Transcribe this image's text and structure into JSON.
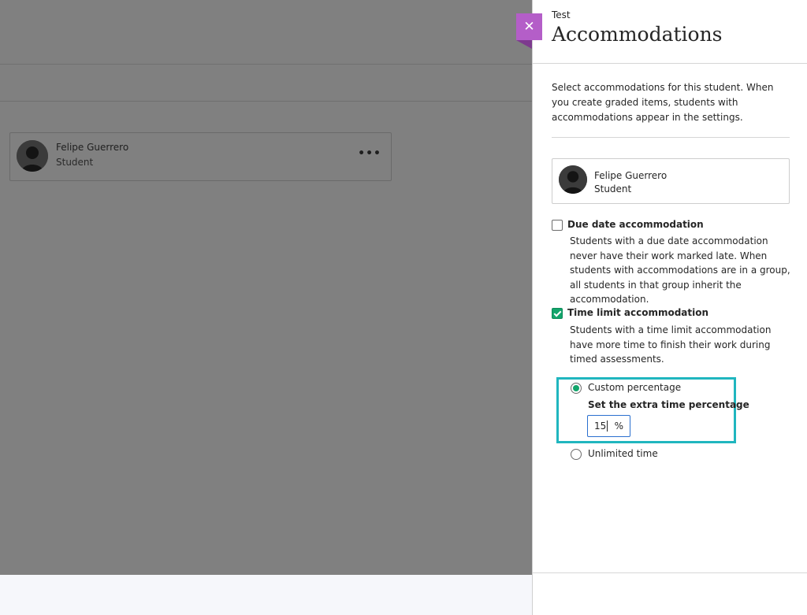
{
  "background": {
    "card": {
      "name": "Felipe Guerrero",
      "role": "Student",
      "more_icon": "more-horizontal-icon"
    }
  },
  "panel": {
    "kicker": "Test",
    "title": "Accommodations",
    "close_icon": "close-icon",
    "intro": "Select accommodations for this student. When you create graded items, students with accommodations appear in the settings.",
    "student": {
      "name": "Felipe Guerrero",
      "role": "Student"
    },
    "due_date": {
      "label": "Due date accommodation",
      "checked": false,
      "description": "Students with a due date accommodation never have their work marked late. When students with accommodations are in a group, all students in that group inherit the accommodation."
    },
    "time_limit": {
      "label": "Time limit accommodation",
      "checked": true,
      "description": "Students with a time limit accommodation have more time to finish their work during timed assessments.",
      "options": {
        "custom_label": "Custom percentage",
        "custom_selected": true,
        "extra_label": "Set the extra time percentage",
        "percent_value": "15",
        "percent_sign": "%",
        "unlimited_label": "Unlimited time",
        "unlimited_selected": false
      }
    }
  },
  "colors": {
    "accent_close": "#b45ec8",
    "check_green": "#13a56c",
    "highlight": "#20b6bf",
    "overlay": "#808080"
  }
}
